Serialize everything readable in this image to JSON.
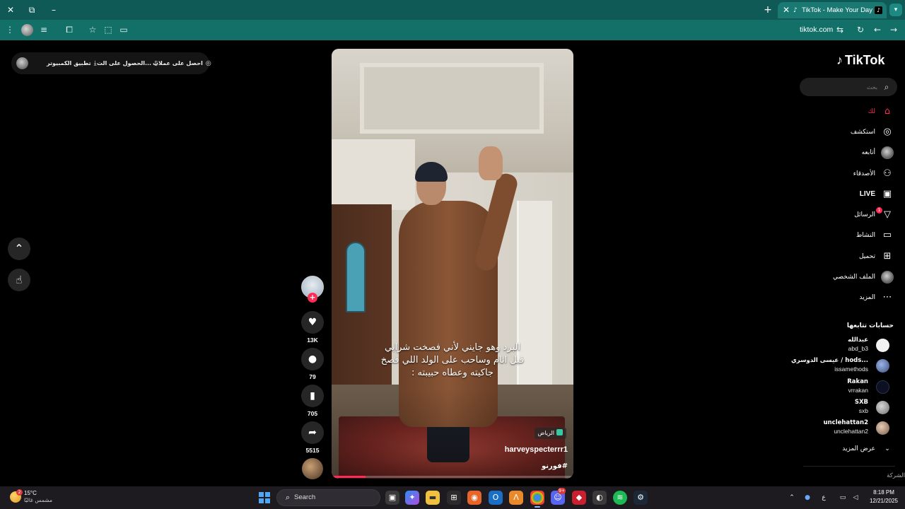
{
  "browser": {
    "tab_title": "TikTok - Make Your Day",
    "url": "tiktok.com",
    "icons": {
      "close_window": "close-icon",
      "restore": "restore-icon",
      "minimize": "minimize-icon",
      "new_tab": "plus-icon",
      "tab_menu": "chevron-down-icon"
    }
  },
  "topbar": {
    "get_coins": "احصل على عملات",
    "get_app": "الحصول على الت...",
    "desktop_app": "تطبيق الكمبيوتر"
  },
  "video": {
    "caption_lines": [
      "البرد وهو جايني لأني فصخت شرابي",
      "قبل انام وساحب على الولد اللي فصخ",
      "جاكيته وعطاه حبيبته :"
    ],
    "location": "الرياض",
    "author": "harveyspecterrr1",
    "hashtag": "#فورنو",
    "progress_percent": 14,
    "likes": "13K",
    "comments": "79",
    "saves": "705",
    "shares": "5515"
  },
  "sidebar": {
    "logo": "TikTok",
    "search_placeholder": "بحث",
    "nav": [
      {
        "label": "لك",
        "icon": "home-icon"
      },
      {
        "label": "استكشف",
        "icon": "compass-icon"
      },
      {
        "label": "أتابعه",
        "icon": "following-icon"
      },
      {
        "label": "الأصدقاء",
        "icon": "friends-icon"
      },
      {
        "label": "LIVE",
        "icon": "live-icon"
      },
      {
        "label": "الرسائل",
        "icon": "messages-icon",
        "badge": "1"
      },
      {
        "label": "النشاط",
        "icon": "activity-icon"
      },
      {
        "label": "تحميل",
        "icon": "upload-icon"
      },
      {
        "label": "الملف الشخصي",
        "icon": "profile-avatar"
      },
      {
        "label": "المزيد",
        "icon": "more-icon"
      }
    ],
    "following_heading": "حسابات تتابعها",
    "accounts": [
      {
        "name": "عبدالله",
        "handle": "abd_b3"
      },
      {
        "name": "عيسى الدوسري / hods...",
        "handle": "issamethods"
      },
      {
        "name": "Rakan",
        "handle": "vrrakan"
      },
      {
        "name": "SXB",
        "handle": "sxb"
      },
      {
        "name": "unclehattan2",
        "handle": "unclehattan2"
      }
    ],
    "show_more": "عرض المزيد",
    "company": "الشركة"
  },
  "taskbar": {
    "temperature": "15°C",
    "condition": "مشمس غالبًا",
    "weather_badge": "2",
    "search_label": "Search",
    "time": "8:18 PM",
    "date": "12/21/2025",
    "language": "ع",
    "discord_badge": "9+"
  },
  "colors": {
    "accent": "#fe2c55",
    "chrome_tabbar": "#0f5a56",
    "chrome_toolbar": "#127069",
    "taskbar": "#1d1b20"
  }
}
